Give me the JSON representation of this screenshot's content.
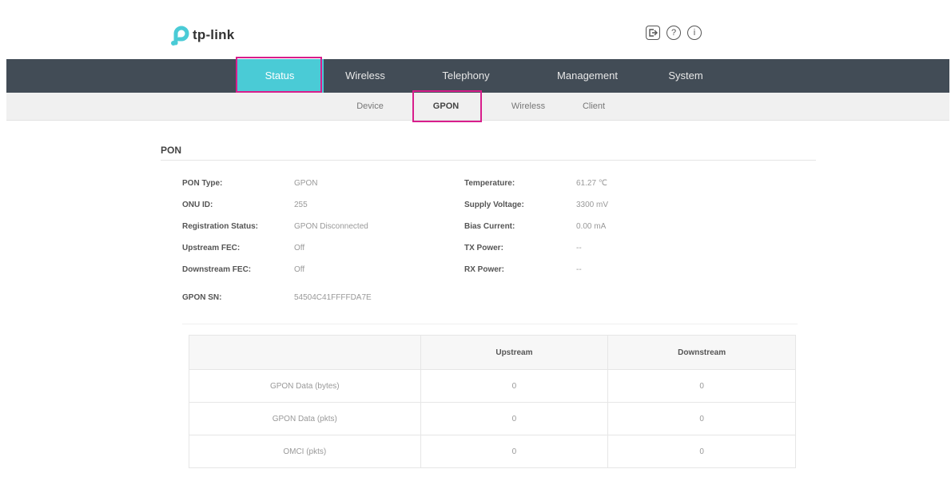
{
  "brand": {
    "name": "tp-link",
    "color": "#4acbd6"
  },
  "header_icons": [
    {
      "name": "logout-icon",
      "glyph": "⇤"
    },
    {
      "name": "help-icon",
      "glyph": "?"
    },
    {
      "name": "info-icon",
      "glyph": "i"
    }
  ],
  "main_nav": {
    "items": [
      "Status",
      "Wireless",
      "Telephony",
      "Management",
      "System"
    ],
    "active": "Status"
  },
  "sub_nav": {
    "items": [
      "Device",
      "GPON",
      "Wireless",
      "Client"
    ],
    "active": "GPON"
  },
  "section": {
    "title": "PON"
  },
  "pon_info": {
    "left": [
      {
        "label": "PON Type:",
        "value": "GPON"
      },
      {
        "label": "ONU ID:",
        "value": "255"
      },
      {
        "label": "Registration Status:",
        "value": "GPON Disconnected"
      },
      {
        "label": "Upstream FEC:",
        "value": "Off"
      },
      {
        "label": "Downstream FEC:",
        "value": "Off"
      },
      {
        "label": "GPON SN:",
        "value": "54504C41FFFFDA7E"
      }
    ],
    "right": [
      {
        "label": "Temperature:",
        "value": "61.27 ℃"
      },
      {
        "label": "Supply Voltage:",
        "value": "3300 mV"
      },
      {
        "label": "Bias Current:",
        "value": "0.00 mA"
      },
      {
        "label": "TX Power:",
        "value": "--"
      },
      {
        "label": "RX Power:",
        "value": "--"
      }
    ]
  },
  "stats_table": {
    "headers": [
      "",
      "Upstream",
      "Downstream"
    ],
    "rows": [
      [
        "GPON Data (bytes)",
        "0",
        "0"
      ],
      [
        "GPON Data (pkts)",
        "0",
        "0"
      ],
      [
        "OMCI (pkts)",
        "0",
        "0"
      ]
    ]
  }
}
